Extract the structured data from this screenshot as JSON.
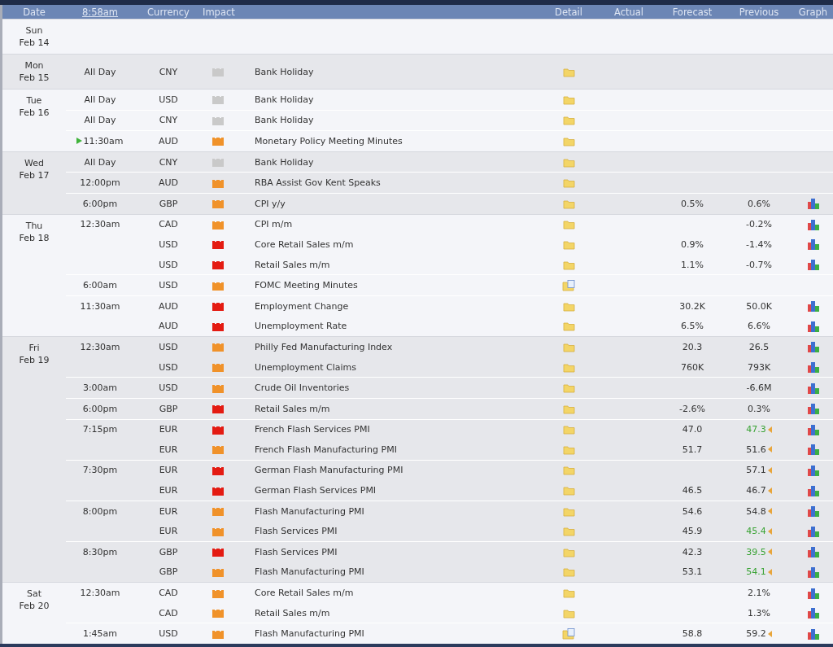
{
  "header": {
    "columns": [
      {
        "kind": "date",
        "label": "Date"
      },
      {
        "kind": "clock",
        "label": "8:58am"
      },
      {
        "kind": "currency",
        "label": "Currency"
      },
      {
        "kind": "impact",
        "label": "Impact"
      },
      {
        "kind": "event"
      },
      {
        "kind": "detail",
        "label": "Detail"
      },
      {
        "kind": "actual",
        "label": "Actual"
      },
      {
        "kind": "forecast",
        "label": "Forecast"
      },
      {
        "kind": "previous",
        "label": "Previous"
      },
      {
        "kind": "graph",
        "label": "Graph"
      }
    ]
  },
  "days": [
    {
      "day": "Sun",
      "date": "Feb 14"
    },
    {
      "day": "Mon",
      "date": "Feb 15",
      "groups": [
        {
          "time": "All Day",
          "upcoming": false,
          "events": [
            {
              "currency": "CNY",
              "kind": "holiday",
              "title": "Bank Holiday",
              "detail_document": false,
              "previous_better": false,
              "revised": false,
              "graph": false
            }
          ]
        }
      ]
    },
    {
      "day": "Tue",
      "date": "Feb 16",
      "groups": [
        {
          "time": "All Day",
          "upcoming": false,
          "events": [
            {
              "currency": "USD",
              "kind": "holiday",
              "title": "Bank Holiday",
              "detail_document": false,
              "previous_better": false,
              "revised": false,
              "graph": false
            }
          ]
        },
        {
          "time": "All Day",
          "upcoming": false,
          "events": [
            {
              "currency": "CNY",
              "kind": "holiday",
              "title": "Bank Holiday",
              "detail_document": false,
              "previous_better": false,
              "revised": false,
              "graph": false
            }
          ]
        },
        {
          "time": "11:30am",
          "upcoming": true,
          "events": [
            {
              "currency": "AUD",
              "kind": "medium",
              "title": "Monetary Policy Meeting Minutes",
              "detail_document": false,
              "previous_better": false,
              "revised": false,
              "graph": false
            }
          ]
        }
      ]
    },
    {
      "day": "Wed",
      "date": "Feb 17",
      "groups": [
        {
          "time": "All Day",
          "upcoming": false,
          "events": [
            {
              "currency": "CNY",
              "kind": "holiday",
              "title": "Bank Holiday",
              "detail_document": false,
              "previous_better": false,
              "revised": false,
              "graph": false
            }
          ]
        },
        {
          "time": "12:00pm",
          "upcoming": false,
          "events": [
            {
              "currency": "AUD",
              "kind": "medium",
              "title": "RBA Assist Gov Kent Speaks",
              "detail_document": false,
              "previous_better": false,
              "revised": false,
              "graph": false
            }
          ]
        },
        {
          "time": "6:00pm",
          "upcoming": false,
          "events": [
            {
              "currency": "GBP",
              "kind": "medium",
              "title": "CPI y/y",
              "detail_document": false,
              "forecast": "0.5%",
              "previous": "0.6%",
              "previous_better": false,
              "revised": false,
              "graph": true
            }
          ]
        }
      ]
    },
    {
      "day": "Thu",
      "date": "Feb 18",
      "groups": [
        {
          "time": "12:30am",
          "upcoming": false,
          "events": [
            {
              "currency": "CAD",
              "kind": "medium",
              "title": "CPI m/m",
              "detail_document": false,
              "previous": "-0.2%",
              "previous_better": false,
              "revised": false,
              "graph": true
            },
            {
              "currency": "USD",
              "kind": "high",
              "title": "Core Retail Sales m/m",
              "detail_document": false,
              "forecast": "0.9%",
              "previous": "-1.4%",
              "previous_better": false,
              "revised": false,
              "graph": true
            },
            {
              "currency": "USD",
              "kind": "high",
              "title": "Retail Sales m/m",
              "detail_document": false,
              "forecast": "1.1%",
              "previous": "-0.7%",
              "previous_better": false,
              "revised": false,
              "graph": true
            }
          ]
        },
        {
          "time": "6:00am",
          "upcoming": false,
          "events": [
            {
              "currency": "USD",
              "kind": "medium",
              "title": "FOMC Meeting Minutes",
              "detail_document": true,
              "previous_better": false,
              "revised": false,
              "graph": false
            }
          ]
        },
        {
          "time": "11:30am",
          "upcoming": false,
          "events": [
            {
              "currency": "AUD",
              "kind": "high",
              "title": "Employment Change",
              "detail_document": false,
              "forecast": "30.2K",
              "previous": "50.0K",
              "previous_better": false,
              "revised": false,
              "graph": true
            },
            {
              "currency": "AUD",
              "kind": "high",
              "title": "Unemployment Rate",
              "detail_document": false,
              "forecast": "6.5%",
              "previous": "6.6%",
              "previous_better": false,
              "revised": false,
              "graph": true
            }
          ]
        }
      ]
    },
    {
      "day": "Fri",
      "date": "Feb 19",
      "groups": [
        {
          "time": "12:30am",
          "upcoming": false,
          "events": [
            {
              "currency": "USD",
              "kind": "medium",
              "title": "Philly Fed Manufacturing Index",
              "detail_document": false,
              "forecast": "20.3",
              "previous": "26.5",
              "previous_better": false,
              "revised": false,
              "graph": true
            },
            {
              "currency": "USD",
              "kind": "medium",
              "title": "Unemployment Claims",
              "detail_document": false,
              "forecast": "760K",
              "previous": "793K",
              "previous_better": false,
              "revised": false,
              "graph": true
            }
          ]
        },
        {
          "time": "3:00am",
          "upcoming": false,
          "events": [
            {
              "currency": "USD",
              "kind": "medium",
              "title": "Crude Oil Inventories",
              "detail_document": false,
              "previous": "-6.6M",
              "previous_better": false,
              "revised": false,
              "graph": true
            }
          ]
        },
        {
          "time": "6:00pm",
          "upcoming": false,
          "events": [
            {
              "currency": "GBP",
              "kind": "high",
              "title": "Retail Sales m/m",
              "detail_document": false,
              "forecast": "-2.6%",
              "previous": "0.3%",
              "previous_better": false,
              "revised": false,
              "graph": true
            }
          ]
        },
        {
          "time": "7:15pm",
          "upcoming": false,
          "events": [
            {
              "currency": "EUR",
              "kind": "high",
              "title": "French Flash Services PMI",
              "detail_document": false,
              "forecast": "47.0",
              "previous": "47.3",
              "previous_better": true,
              "revised": true,
              "graph": true
            },
            {
              "currency": "EUR",
              "kind": "medium",
              "title": "French Flash Manufacturing PMI",
              "detail_document": false,
              "forecast": "51.7",
              "previous": "51.6",
              "previous_better": false,
              "revised": true,
              "graph": true
            }
          ]
        },
        {
          "time": "7:30pm",
          "upcoming": false,
          "events": [
            {
              "currency": "EUR",
              "kind": "high",
              "title": "German Flash Manufacturing PMI",
              "detail_document": false,
              "previous": "57.1",
              "previous_better": false,
              "revised": true,
              "graph": true
            },
            {
              "currency": "EUR",
              "kind": "high",
              "title": "German Flash Services PMI",
              "detail_document": false,
              "forecast": "46.5",
              "previous": "46.7",
              "previous_better": false,
              "revised": true,
              "graph": true
            }
          ]
        },
        {
          "time": "8:00pm",
          "upcoming": false,
          "events": [
            {
              "currency": "EUR",
              "kind": "medium",
              "title": "Flash Manufacturing PMI",
              "detail_document": false,
              "forecast": "54.6",
              "previous": "54.8",
              "previous_better": false,
              "revised": true,
              "graph": true
            },
            {
              "currency": "EUR",
              "kind": "medium",
              "title": "Flash Services PMI",
              "detail_document": false,
              "forecast": "45.9",
              "previous": "45.4",
              "previous_better": true,
              "revised": true,
              "graph": true
            }
          ]
        },
        {
          "time": "8:30pm",
          "upcoming": false,
          "events": [
            {
              "currency": "GBP",
              "kind": "high",
              "title": "Flash Services PMI",
              "detail_document": false,
              "forecast": "42.3",
              "previous": "39.5",
              "previous_better": true,
              "revised": true,
              "graph": true
            },
            {
              "currency": "GBP",
              "kind": "medium",
              "title": "Flash Manufacturing PMI",
              "detail_document": false,
              "forecast": "53.1",
              "previous": "54.1",
              "previous_better": true,
              "revised": true,
              "graph": true
            }
          ]
        }
      ]
    },
    {
      "day": "Sat",
      "date": "Feb 20",
      "groups": [
        {
          "time": "12:30am",
          "upcoming": false,
          "events": [
            {
              "currency": "CAD",
              "kind": "medium",
              "title": "Core Retail Sales m/m",
              "detail_document": false,
              "previous": "2.1%",
              "previous_better": false,
              "revised": false,
              "graph": true
            },
            {
              "currency": "CAD",
              "kind": "medium",
              "title": "Retail Sales m/m",
              "detail_document": false,
              "previous": "1.3%",
              "previous_better": false,
              "revised": false,
              "graph": true
            }
          ]
        },
        {
          "time": "1:45am",
          "upcoming": false,
          "events": [
            {
              "currency": "USD",
              "kind": "medium",
              "title": "Flash Manufacturing PMI",
              "detail_document": true,
              "forecast": "58.8",
              "previous": "59.2",
              "previous_better": false,
              "revised": true,
              "graph": true
            }
          ]
        }
      ]
    }
  ]
}
